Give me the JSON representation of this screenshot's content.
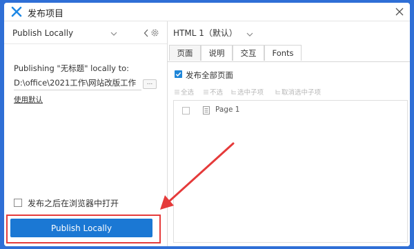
{
  "window": {
    "title": "发布项目",
    "logo_icon": "axure-logo-icon",
    "close_icon": "close-icon"
  },
  "left_pane": {
    "target_label": "Publish Locally",
    "publish_description": "Publishing \"无标题\" locally to:",
    "path_value": "D:\\office\\2021工作\\网站改版工作",
    "browse_label": "...",
    "use_default_label": "使用默认",
    "open_after_label": "发布之后在浏览器中打开",
    "open_after_checked": false,
    "publish_button_label": "Publish Locally"
  },
  "right_pane": {
    "page_select_label": "HTML 1（默认）",
    "tabs": [
      {
        "label": "页面",
        "active": true
      },
      {
        "label": "说明",
        "active": false
      },
      {
        "label": "交互",
        "active": false
      },
      {
        "label": "Fonts",
        "active": false
      }
    ],
    "publish_all_label": "发布全部页面",
    "publish_all_checked": true,
    "toolbar": {
      "select_all": "全选",
      "deselect": "不选",
      "select_children": "选中子项",
      "deselect_children": "取消选中子项"
    },
    "pages": [
      {
        "label": "Page 1",
        "checked": false
      }
    ]
  },
  "colors": {
    "frame": "#2f6fd6",
    "primary_button": "#1b78d4",
    "highlight": "#e53a3a",
    "checkbox": "#1f86d8"
  }
}
